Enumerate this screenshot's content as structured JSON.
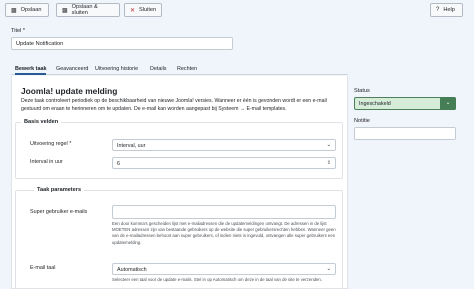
{
  "toolbar": {
    "save_label": "Opslaan",
    "save_close_label": "Opslaan & sluiten",
    "close_label": "Sluiten",
    "help_label": "Help"
  },
  "title_field": {
    "label": "Titel *",
    "value": "Update Notification"
  },
  "tabs": [
    {
      "label": "Bewerk taak",
      "active": true
    },
    {
      "label": "Geavanceerd"
    },
    {
      "label": "Uitvoering historie"
    },
    {
      "label": "Details"
    },
    {
      "label": "Rechten"
    }
  ],
  "main": {
    "heading": "Joomla! update melding",
    "description": "Deze taak controleert periodiek op de beschikbaarheid van nieuwe Joomla! versies. Wanneer er één is gevonden wordt er een e-mail gestuurd om eraan te herinneren om te updaten. De e-mail kan worden aangepast bij Systeem → E-mail templates."
  },
  "basis": {
    "legend": "Basis velden",
    "rule_label": "Uitvoering regel *",
    "rule_value": "Interval, uur",
    "interval_label": "Interval in uur",
    "interval_value": "6"
  },
  "params": {
    "legend": "Taak parameters",
    "super_label": "Super gebruiker e-mails",
    "super_help": "Een door komma's gescheiden lijst met e-mailadressen die de updatemeldingen ontvangt. De adressen in de lijst MOETEN adressen zijn van bestaande gebruikers op de website die super gebruikersrechten hebben. Wanneer geen van de e-mailadressen behoort aan super gebruikers, of indien niets is ingevuld, ontvangen alle super gebruikers een updatemelding.",
    "lang_label": "E-mail taal",
    "lang_value": "Automatisch",
    "lang_help": "Selecteer een taal voor de update e-mails. Stel in op Automatisch om deze in de taal van de site te verzenden."
  },
  "sidebar": {
    "status_label": "Status",
    "status_value": "Ingeschakeld",
    "note_label": "Notitie"
  },
  "colors": {
    "accent": "#2a5a94",
    "status_bg": "#d5ecd9",
    "status_btn": "#457d54",
    "close_icon": "#c52827"
  }
}
